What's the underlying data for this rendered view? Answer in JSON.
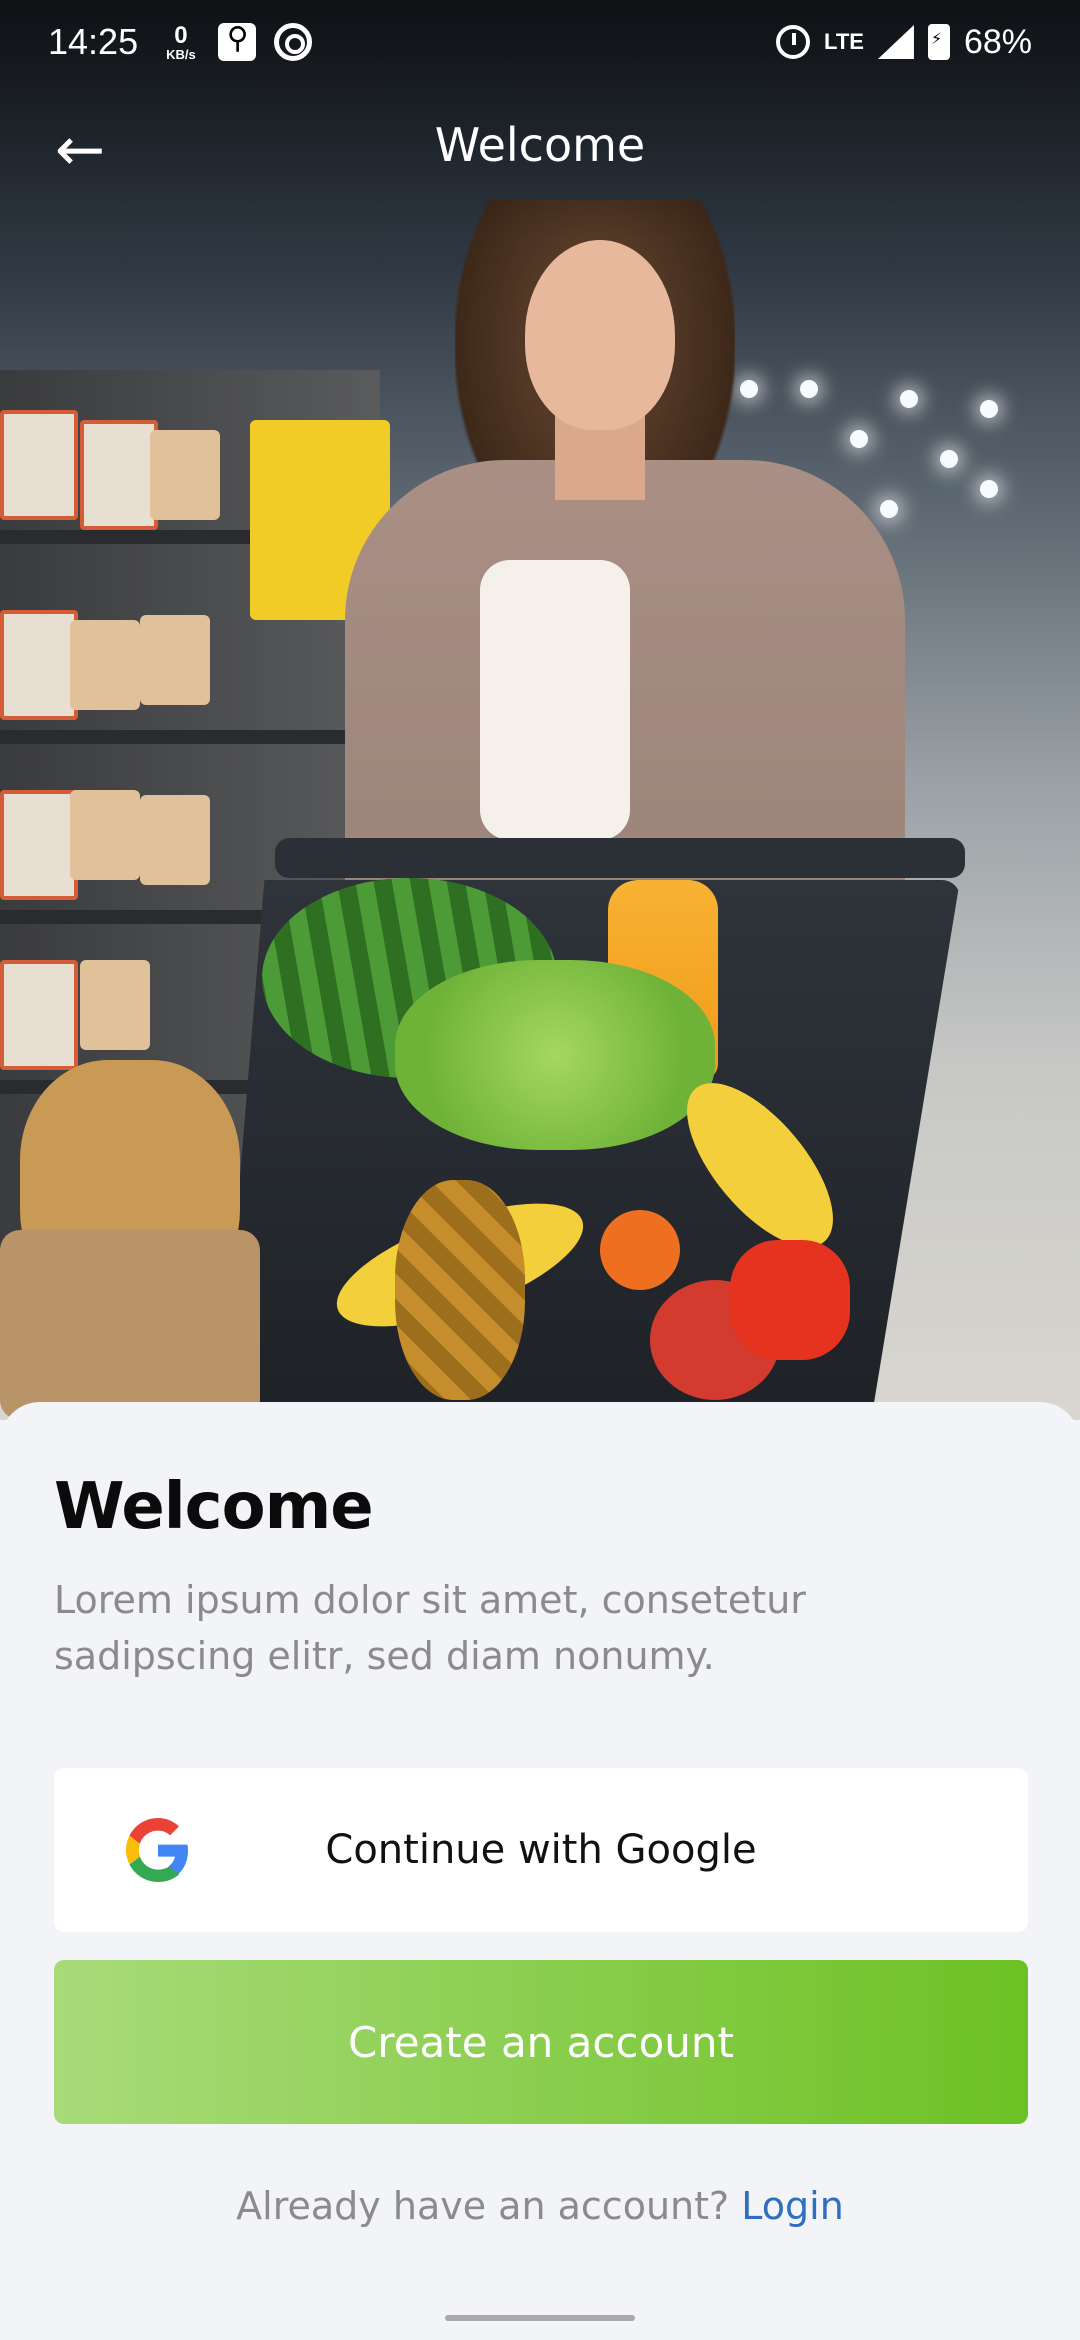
{
  "status_bar": {
    "time": "14:25",
    "net_speed_value": "0",
    "net_speed_unit": "KB/s",
    "network_type": "LTE",
    "battery_percent": "68%"
  },
  "app_bar": {
    "title": "Welcome",
    "back_icon": "arrow-left-icon"
  },
  "sheet": {
    "title": "Welcome",
    "description": "Lorem ipsum dolor sit amet, consetetur sadipscing elitr, sed diam nonumy."
  },
  "buttons": {
    "google_label": "Continue with Google",
    "google_icon": "google-logo-icon",
    "create_label": "Create an account"
  },
  "login": {
    "prompt": "Already have an account?",
    "link_label": "Login"
  },
  "colors": {
    "accent_green_start": "#a8db79",
    "accent_green_end": "#6dc124",
    "link_blue": "#2f6fbe"
  }
}
